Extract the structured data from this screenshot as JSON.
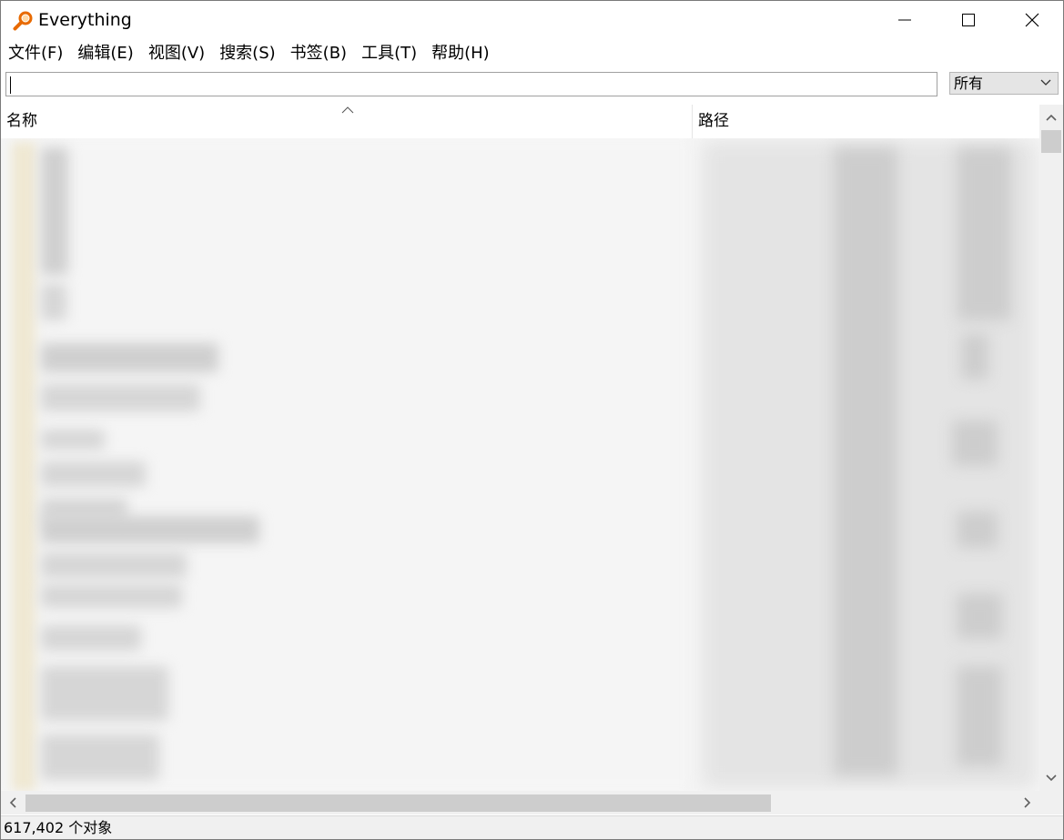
{
  "window": {
    "title": "Everything",
    "icon": "magnifier-icon"
  },
  "menubar": {
    "items": [
      {
        "label": "文件(F)"
      },
      {
        "label": "编辑(E)"
      },
      {
        "label": "视图(V)"
      },
      {
        "label": "搜索(S)"
      },
      {
        "label": "书签(B)"
      },
      {
        "label": "工具(T)"
      },
      {
        "label": "帮助(H)"
      }
    ]
  },
  "search": {
    "value": "",
    "filter": "所有"
  },
  "columns": {
    "name": "名称",
    "path": "路径",
    "sort": "ascending"
  },
  "status": {
    "text": "617,402 个对象"
  },
  "colors": {
    "accent_icon": "#e86a00",
    "list_background": "#f6f6f6",
    "scrollbar_thumb": "#cdcdcd"
  }
}
